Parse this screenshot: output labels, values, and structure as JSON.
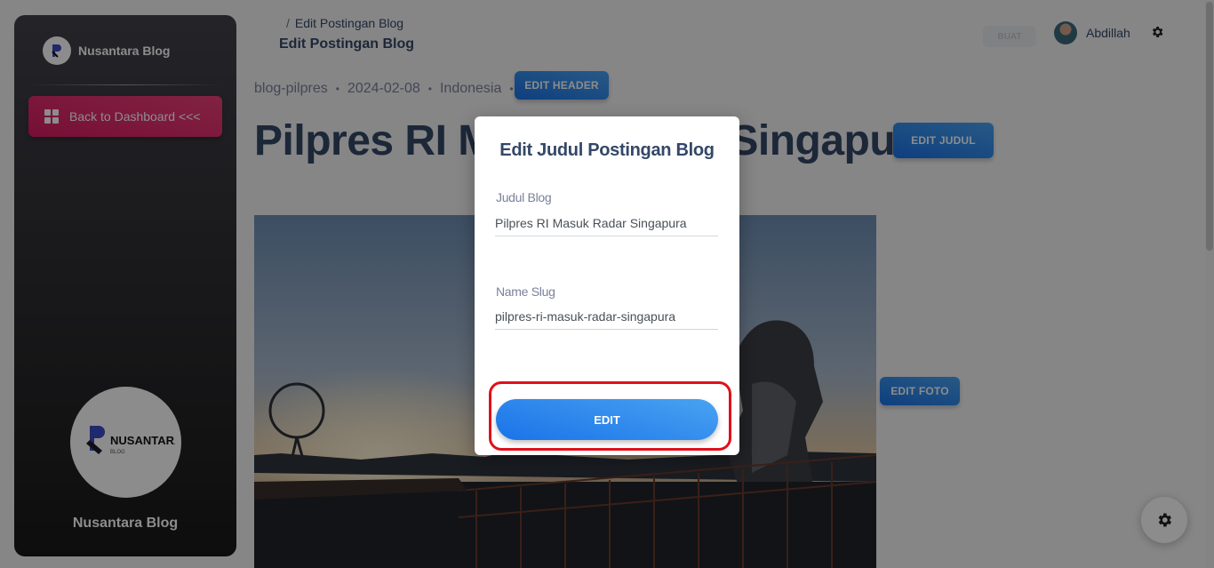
{
  "sidebar": {
    "brand_name": "Nusantara Blog",
    "back_button": "Back to Dashboard <<<",
    "profile_logo_text": "NUSANTARA",
    "profile_logo_sub": "BLOG",
    "profile_name": "Nusantara Blog"
  },
  "navbar": {
    "breadcrumb_sep": "/",
    "breadcrumb_current": "Edit Postingan Blog",
    "page_title": "Edit Postingan Blog",
    "pill": "BUAT",
    "user_name": "Abdillah"
  },
  "post": {
    "slug": "blog-pilpres",
    "date": "2024-02-08",
    "country": "Indonesia",
    "dot": "•",
    "edit_header_label": "EDIT HEADER",
    "title": "Pilpres RI Masuk Radar Singapura",
    "edit_judul_label": "EDIT JUDUL",
    "edit_foto_label": "EDIT FOTO"
  },
  "modal": {
    "title": "Edit Judul Postingan Blog",
    "judul_label": "Judul Blog",
    "judul_value": "Pilpres RI Masuk Radar Singapura",
    "slug_label": "Name Slug",
    "slug_value": "pilpres-ri-masuk-radar-singapura",
    "edit_button": "EDIT"
  },
  "colors": {
    "accent_blue": "#1a73e8",
    "accent_pink": "#e91e63",
    "highlight_red": "#e0101a"
  }
}
